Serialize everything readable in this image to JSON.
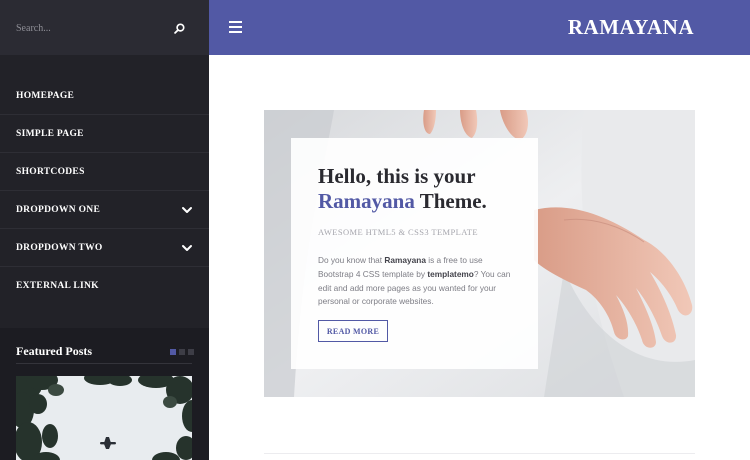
{
  "search": {
    "placeholder": "Search..."
  },
  "nav": {
    "items": [
      {
        "label": "HOMEPAGE"
      },
      {
        "label": "SIMPLE PAGE"
      },
      {
        "label": "SHORTCODES"
      },
      {
        "label": "DROPDOWN ONE"
      },
      {
        "label": "DROPDOWN TWO"
      },
      {
        "label": "EXTERNAL LINK"
      }
    ]
  },
  "featured": {
    "title": "Featured Posts"
  },
  "header": {
    "logo": "RAMAYANA"
  },
  "hero": {
    "title_line1": "Hello, this is your",
    "title_accent": "Ramayana",
    "title_end": " Theme.",
    "subtitle": "AWESOME HTML5 & CSS3 TEMPLATE",
    "text_1": "Do you know that ",
    "text_brand": "Ramayana",
    "text_2": " is a free to use Bootstrap 4 CSS template by ",
    "text_author": "templatemo",
    "text_3": "? You can edit and add more pages as you wanted for your personal or corporate websites.",
    "button_label": "READ MORE"
  },
  "colors": {
    "accent": "#5259a5",
    "sidebar": "#222228",
    "search_bg": "#2b2b33"
  },
  "icons": {
    "search": "search-icon",
    "menu": "hamburger-icon",
    "dropdown": "chevron-down-icon"
  }
}
